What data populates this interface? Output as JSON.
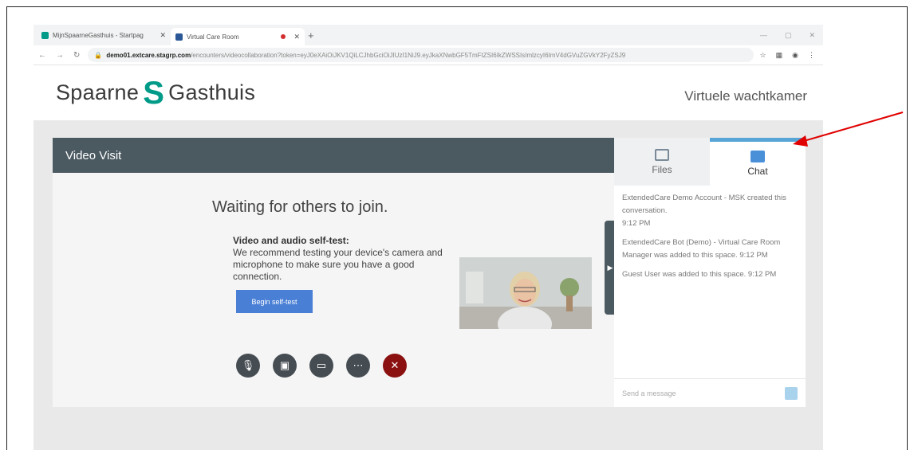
{
  "browser": {
    "tabs": [
      {
        "title": "MijnSpaarneGasthuis - Startpag",
        "favicon_color": "#009a88"
      },
      {
        "title": "Virtual Care Room",
        "favicon_color": "#2b5797"
      }
    ],
    "address": {
      "host": "demo01.extcare.stagrp.com",
      "path": "/encounters/videocollaboration?token=eyJ0eXAiOiJKV1QiLCJhbGciOiJIUzI1NiJ9.eyJkaXNwbGF5TmFtZSI6IkZWSSIsImlzcyI6ImV4dGVuZGVkY2FyZSJ9"
    }
  },
  "site": {
    "logo_left": "Spaarne",
    "logo_mark": "S",
    "logo_right": "Gasthuis",
    "waiting_room": "Virtuele wachtkamer"
  },
  "video": {
    "header": "Video Visit",
    "waiting_text": "Waiting for others to join.",
    "selftest_title": "Video and audio self-test:",
    "selftest_body": "We recommend testing your device's camera and microphone to make sure you have a good connection.",
    "begin_button": "Begin self-test",
    "controls": [
      "microphone-icon",
      "camera-icon",
      "share-screen-icon",
      "more-icon",
      "hang-up-icon"
    ]
  },
  "sidebar": {
    "tabs": [
      {
        "label": "Files"
      },
      {
        "label": "Chat"
      }
    ],
    "messages": [
      {
        "text": "ExtendedCare Demo Account - MSK created this conversation.",
        "time": "9:12 PM"
      },
      {
        "text": "ExtendedCare Bot (Demo) - Virtual Care Room Manager was added to this space.",
        "time": "9:12 PM"
      },
      {
        "text": "Guest User was added to this space.",
        "time": "9:12 PM"
      }
    ],
    "input_placeholder": "Send a message"
  },
  "colors": {
    "brand": "#009a88",
    "header": "#4b5961",
    "button": "#4a7fd6",
    "accent": "#57a5d6",
    "end_call": "#8b1111",
    "annotation_arrow": "#e00000"
  }
}
